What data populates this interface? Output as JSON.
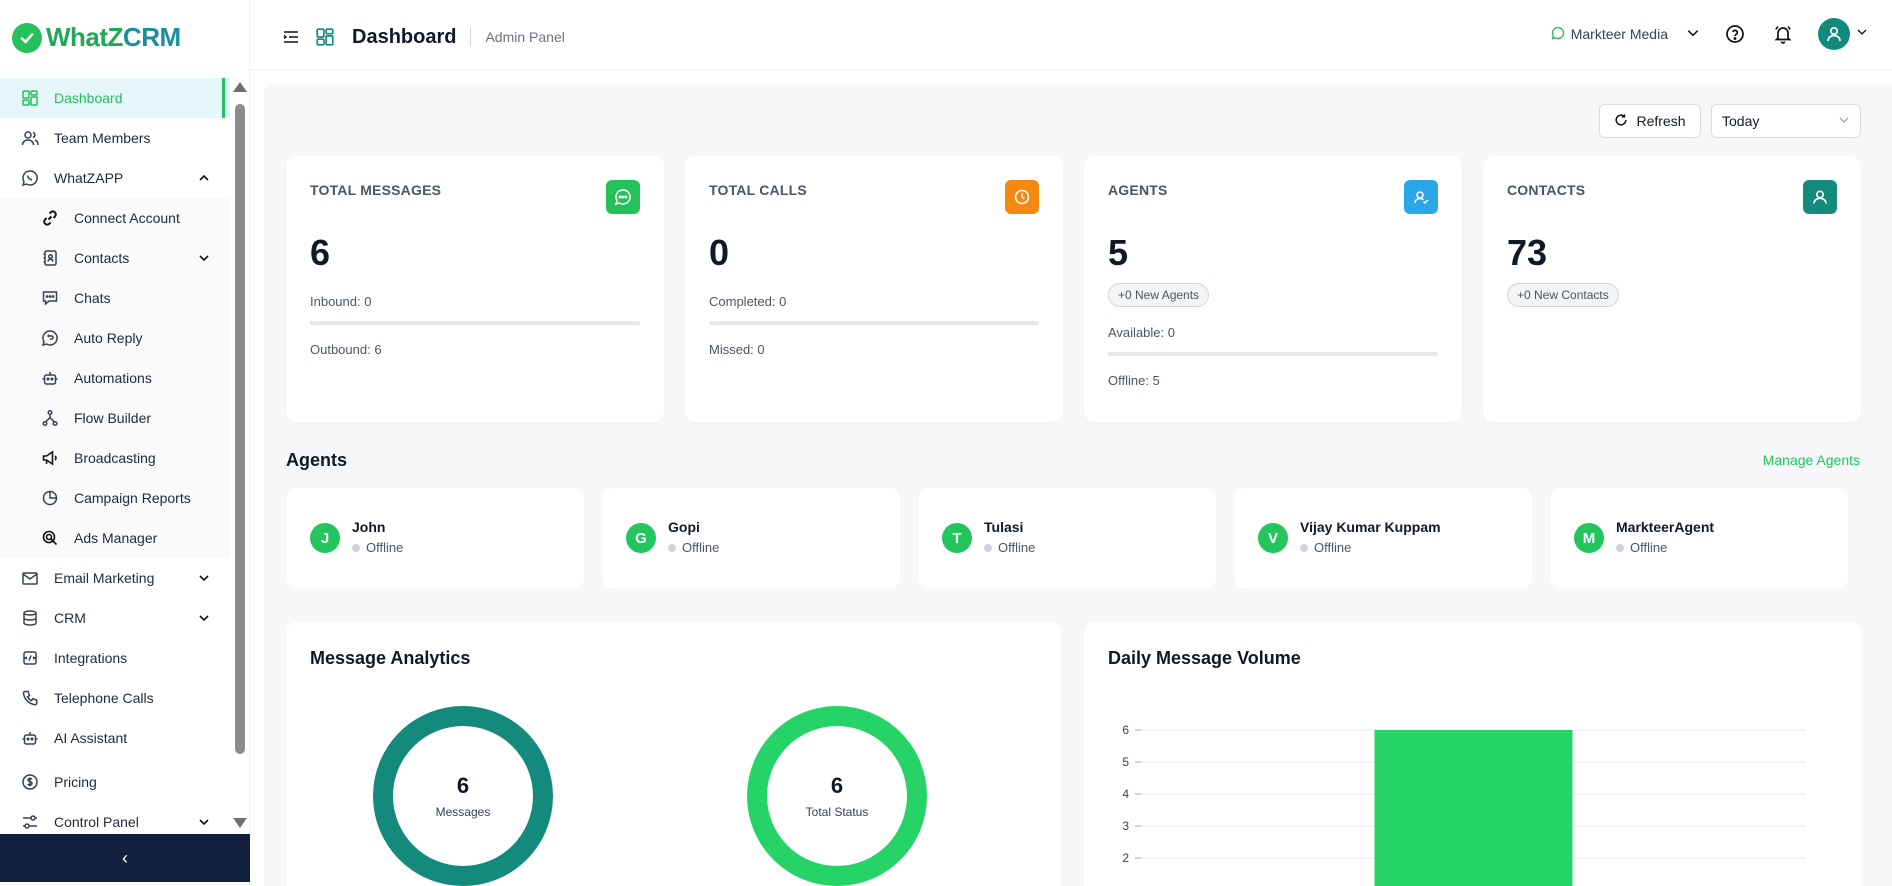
{
  "brand": {
    "name_a": "WhatZ",
    "name_b": "CRM"
  },
  "sidebar": {
    "items": [
      {
        "label": "Dashboard",
        "icon": "dashboard-icon"
      },
      {
        "label": "Team Members",
        "icon": "users-icon"
      },
      {
        "label": "WhatZAPP",
        "icon": "whatsapp-icon"
      }
    ],
    "sub_items": [
      {
        "label": "Connect Account",
        "icon": "link-icon"
      },
      {
        "label": "Contacts",
        "icon": "contacts-icon"
      },
      {
        "label": "Chats",
        "icon": "chat-icon"
      },
      {
        "label": "Auto Reply",
        "icon": "auto-reply-icon"
      },
      {
        "label": "Automations",
        "icon": "robot-icon"
      },
      {
        "label": "Flow Builder",
        "icon": "flow-icon"
      },
      {
        "label": "Broadcasting",
        "icon": "megaphone-icon"
      },
      {
        "label": "Campaign Reports",
        "icon": "report-icon"
      },
      {
        "label": "Ads Manager",
        "icon": "ads-icon"
      }
    ],
    "bottom_items": [
      {
        "label": "Email Marketing",
        "icon": "mail-icon"
      },
      {
        "label": "CRM",
        "icon": "database-icon"
      },
      {
        "label": "Integrations",
        "icon": "integrations-icon"
      },
      {
        "label": "Telephone Calls",
        "icon": "phone-icon"
      },
      {
        "label": "AI Assistant",
        "icon": "ai-bot-icon"
      },
      {
        "label": "Pricing",
        "icon": "dollar-icon"
      },
      {
        "label": "Control Panel",
        "icon": "sliders-icon"
      }
    ],
    "collapse_glyph": "‹"
  },
  "header": {
    "title": "Dashboard",
    "subtitle": "Admin Panel",
    "workspace": "Markteer Media"
  },
  "toolbar": {
    "refresh_label": "Refresh",
    "range_value": "Today"
  },
  "stats": {
    "messages": {
      "title": "TOTAL MESSAGES",
      "value": "6",
      "line1": "Inbound: 0",
      "line2": "Outbound: 6",
      "color": "#25c05a"
    },
    "calls": {
      "title": "TOTAL CALLS",
      "value": "0",
      "line1": "Completed: 0",
      "line2": "Missed: 0",
      "color": "#f5880f"
    },
    "agents": {
      "title": "AGENTS",
      "value": "5",
      "pill": "+0 New Agents",
      "line1": "Available: 0",
      "line2": "Offline: 5",
      "color": "#2aa7e8"
    },
    "contacts": {
      "title": "CONTACTS",
      "value": "73",
      "pill": "+0 New Contacts",
      "color": "#138a7c"
    }
  },
  "agents_section": {
    "title": "Agents",
    "manage_label": "Manage Agents",
    "list": [
      {
        "initial": "J",
        "name": "John",
        "status": "Offline"
      },
      {
        "initial": "G",
        "name": "Gopi",
        "status": "Offline"
      },
      {
        "initial": "T",
        "name": "Tulasi",
        "status": "Offline"
      },
      {
        "initial": "V",
        "name": "Vijay Kumar Kuppam",
        "status": "Offline"
      },
      {
        "initial": "M",
        "name": "MarkteerAgent",
        "status": "Offline"
      }
    ]
  },
  "analytics": {
    "title": "Message Analytics",
    "donuts": [
      {
        "value": "6",
        "label": "Messages",
        "color": "#138a7c"
      },
      {
        "value": "6",
        "label": "Total Status",
        "color": "#25d366"
      }
    ]
  },
  "volume": {
    "title": "Daily Message Volume"
  },
  "chart_data": {
    "type": "bar",
    "title": "Daily Message Volume",
    "categories": [
      ""
    ],
    "values": [
      6
    ],
    "ylim": [
      0,
      6
    ],
    "yticks": [
      2,
      3,
      4,
      5,
      6
    ],
    "color": "#25d366",
    "grid": true
  }
}
